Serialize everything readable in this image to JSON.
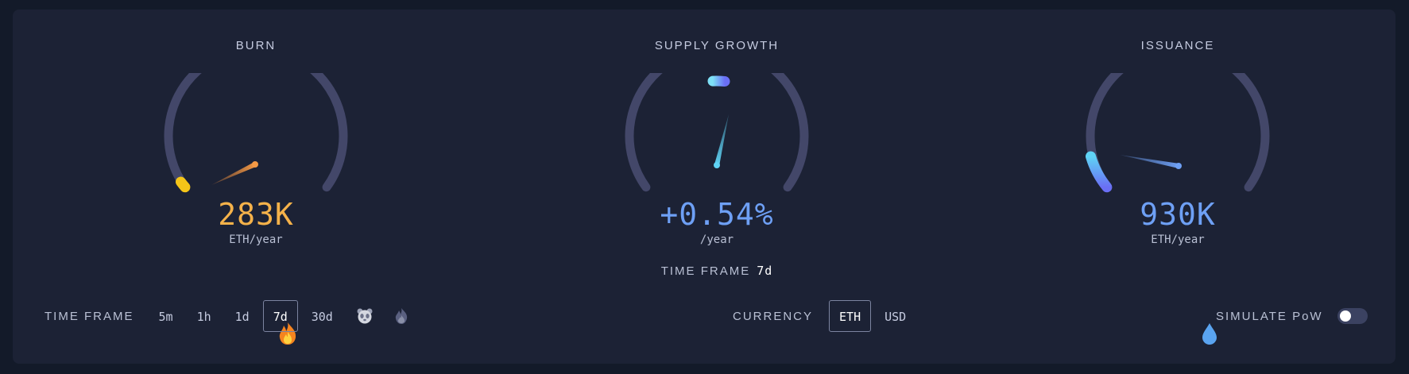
{
  "gauges": {
    "burn": {
      "title": "BURN",
      "value": "283K",
      "unit": "ETH/year",
      "icon": "fire-icon",
      "color": "#f5b24a"
    },
    "supply": {
      "title": "SUPPLY GROWTH",
      "value": "+0.54%",
      "unit": "/year",
      "timeframe_label": "TIME FRAME",
      "timeframe_value": "7d",
      "color": "#6ea0f5"
    },
    "issuance": {
      "title": "ISSUANCE",
      "value": "930K",
      "unit": "ETH/year",
      "icon": "droplet-icon",
      "color": "#6ea0f5"
    }
  },
  "timeframe": {
    "label": "TIME FRAME",
    "options": [
      "5m",
      "1h",
      "1d",
      "7d",
      "30d"
    ],
    "selected": "7d",
    "extra_icons": [
      "panda-icon",
      "since-burn-flame-icon"
    ]
  },
  "currency": {
    "label": "CURRENCY",
    "options": [
      "ETH",
      "USD"
    ],
    "selected": "ETH"
  },
  "simulate": {
    "label": "SIMULATE PoW",
    "enabled": false
  },
  "colors": {
    "background": "#131a29",
    "card": "#1c2235",
    "track": "#434769",
    "burn_accent": "#f5b24a",
    "blue_accent": "#6ea0f5"
  }
}
